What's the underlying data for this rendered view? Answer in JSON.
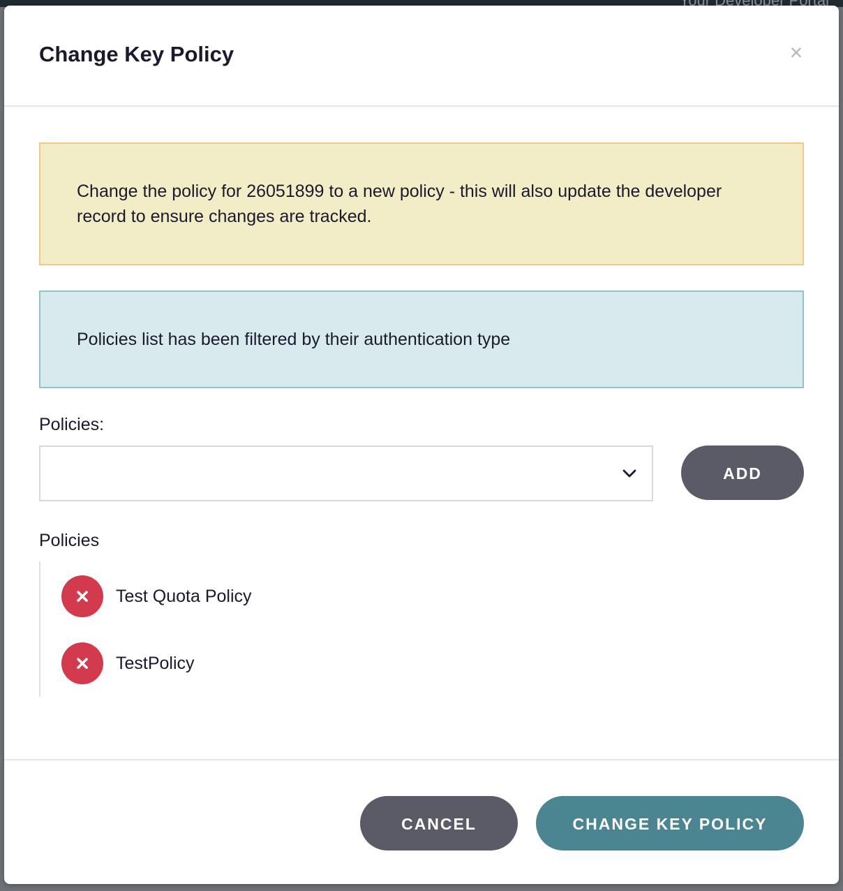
{
  "backdrop": {
    "portal_label": "Your Developer Portal"
  },
  "modal": {
    "title": "Change Key Policy",
    "close_symbol": "×",
    "warning_text": "Change the policy for 26051899 to a new policy - this will also update the developer record to ensure changes are tracked.",
    "info_text": "Policies list has been filtered by their authentication type",
    "policies_field_label": "Policies:",
    "policies_select_value": "",
    "add_label": "ADD",
    "policies_list_title": "Policies",
    "policies": [
      {
        "name": "Test Quota Policy"
      },
      {
        "name": "TestPolicy"
      }
    ],
    "cancel_label": "CANCEL",
    "submit_label": "CHANGE KEY POLICY"
  },
  "colors": {
    "warning_bg": "#f3edc7",
    "warning_border": "#f0c98a",
    "info_bg": "#d8eaee",
    "info_border": "#95c1cc",
    "secondary_button": "#5b5b67",
    "primary_button": "#4a8591",
    "remove_button": "#d23a4d"
  },
  "icons": {
    "close": "close-icon",
    "dropdown": "chevron-down-icon",
    "remove": "remove-x-icon"
  }
}
